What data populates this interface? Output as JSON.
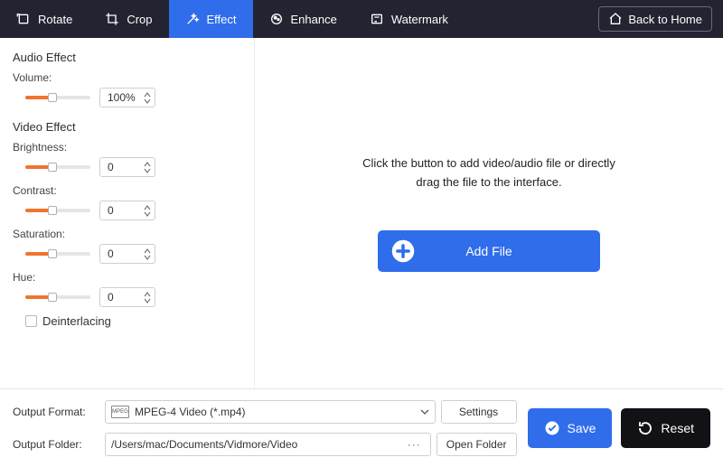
{
  "toolbar": {
    "items": [
      {
        "label": "Rotate"
      },
      {
        "label": "Crop"
      },
      {
        "label": "Effect"
      },
      {
        "label": "Enhance"
      },
      {
        "label": "Watermark"
      }
    ],
    "back_home": "Back to Home"
  },
  "sidebar": {
    "audio_section": "Audio Effect",
    "volume_label": "Volume:",
    "volume_value": "100%",
    "volume_pct": 42,
    "video_section": "Video Effect",
    "brightness_label": "Brightness:",
    "brightness_value": "0",
    "brightness_pct": 42,
    "contrast_label": "Contrast:",
    "contrast_value": "0",
    "contrast_pct": 42,
    "saturation_label": "Saturation:",
    "saturation_value": "0",
    "saturation_pct": 42,
    "hue_label": "Hue:",
    "hue_value": "0",
    "hue_pct": 42,
    "deinterlacing_label": "Deinterlacing"
  },
  "preview": {
    "hint": "Click the button to add video/audio file or directly\ndrag the file to the interface.",
    "add_file_label": "Add File"
  },
  "bottom": {
    "output_format_label": "Output Format:",
    "output_format_value": "MPEG-4 Video (*.mp4)",
    "settings_label": "Settings",
    "output_folder_label": "Output Folder:",
    "output_folder_value": "/Users/mac/Documents/Vidmore/Video",
    "open_folder_label": "Open Folder",
    "save_label": "Save",
    "reset_label": "Reset",
    "format_badge": "MPEG"
  }
}
